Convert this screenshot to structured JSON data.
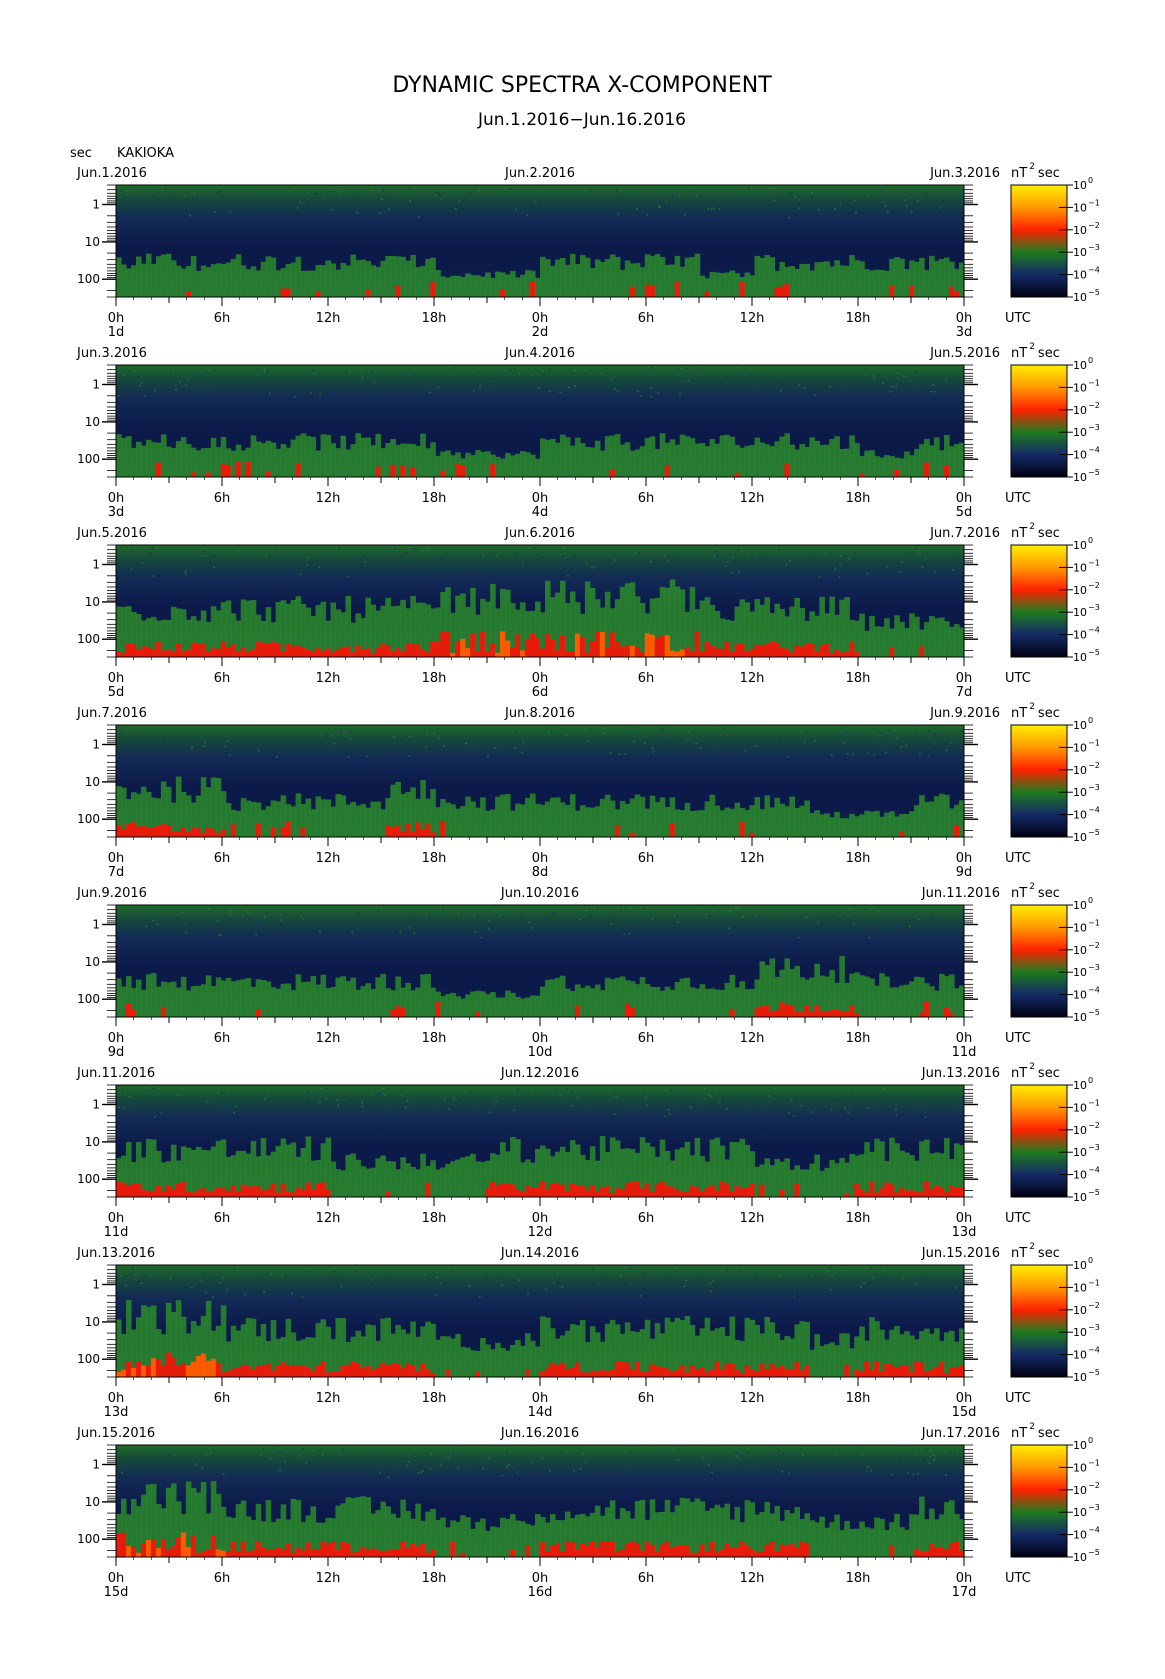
{
  "title": "DYNAMIC SPECTRA X-COMPONENT",
  "subtitle": "Jun.1.2016−Jun.16.2016",
  "unit_left": "sec",
  "station": "KAKIOKA",
  "time_label": "UTC",
  "colorbar_unit_base": "nT",
  "colorbar_unit_exp": "2",
  "colorbar_unit_suffix": "sec",
  "chart_data": {
    "type": "heatmap",
    "x_tick_labels": [
      "0h",
      "6h",
      "12h",
      "18h",
      "0h",
      "6h",
      "12h",
      "18h",
      "0h"
    ],
    "y_tick_labels": [
      "1",
      "10",
      "100"
    ],
    "y_axis": "period (sec), log scale, increasing downward",
    "colorbar": {
      "base": "10",
      "exponents": [
        "0",
        "−1",
        "−2",
        "−3",
        "−4",
        "−5"
      ],
      "colors": [
        "#ffee00",
        "#ff9900",
        "#ff2200",
        "#1f7a1f",
        "#142a66",
        "#000010"
      ]
    },
    "panels": [
      {
        "start_date": "Jun.1.2016",
        "mid_date": "Jun.2.2016",
        "end_date": "Jun.3.2016",
        "day_labels": [
          "1d",
          "2d",
          "3d"
        ],
        "activity": [
          2,
          2,
          2,
          2,
          2,
          2,
          1,
          1,
          2,
          2,
          2,
          1,
          2,
          2,
          2,
          2
        ]
      },
      {
        "start_date": "Jun.3.2016",
        "mid_date": "Jun.4.2016",
        "end_date": "Jun.5.2016",
        "day_labels": [
          "3d",
          "4d",
          "5d"
        ],
        "activity": [
          2,
          2,
          2,
          2,
          2,
          2,
          1,
          1,
          2,
          2,
          2,
          2,
          2,
          2,
          1,
          2
        ]
      },
      {
        "start_date": "Jun.5.2016",
        "mid_date": "Jun.6.2016",
        "end_date": "Jun.7.2016",
        "day_labels": [
          "5d",
          "6d",
          "7d"
        ],
        "activity": [
          3,
          3,
          3,
          3,
          3,
          3,
          4,
          4,
          4,
          4,
          4,
          3,
          3,
          3,
          2,
          2
        ]
      },
      {
        "start_date": "Jun.7.2016",
        "mid_date": "Jun.8.2016",
        "end_date": "Jun.9.2016",
        "day_labels": [
          "7d",
          "8d",
          "9d"
        ],
        "activity": [
          3,
          3,
          2,
          2,
          2,
          3,
          2,
          2,
          2,
          2,
          2,
          2,
          2,
          1,
          1,
          2
        ]
      },
      {
        "start_date": "Jun.9.2016",
        "mid_date": "Jun.10.2016",
        "end_date": "Jun.11.2016",
        "day_labels": [
          "9d",
          "10d",
          "11d"
        ],
        "activity": [
          2,
          2,
          2,
          2,
          2,
          2,
          1,
          1,
          2,
          2,
          2,
          2,
          3,
          3,
          2,
          2
        ]
      },
      {
        "start_date": "Jun.11.2016",
        "mid_date": "Jun.12.2016",
        "end_date": "Jun.13.2016",
        "day_labels": [
          "11d",
          "12d",
          "13d"
        ],
        "activity": [
          3,
          3,
          3,
          3,
          2,
          2,
          2,
          3,
          3,
          3,
          3,
          3,
          2,
          2,
          3,
          3
        ]
      },
      {
        "start_date": "Jun.13.2016",
        "mid_date": "Jun.14.2016",
        "end_date": "Jun.15.2016",
        "day_labels": [
          "13d",
          "14d",
          "15d"
        ],
        "activity": [
          4,
          4,
          3,
          3,
          3,
          3,
          2,
          2,
          3,
          3,
          3,
          3,
          3,
          2,
          3,
          3
        ]
      },
      {
        "start_date": "Jun.15.2016",
        "mid_date": "Jun.16.2016",
        "end_date": "Jun.17.2016",
        "day_labels": [
          "15d",
          "16d",
          "17d"
        ],
        "activity": [
          4,
          4,
          3,
          3,
          3,
          3,
          2,
          2,
          3,
          3,
          3,
          3,
          3,
          2,
          2,
          3
        ]
      }
    ]
  }
}
